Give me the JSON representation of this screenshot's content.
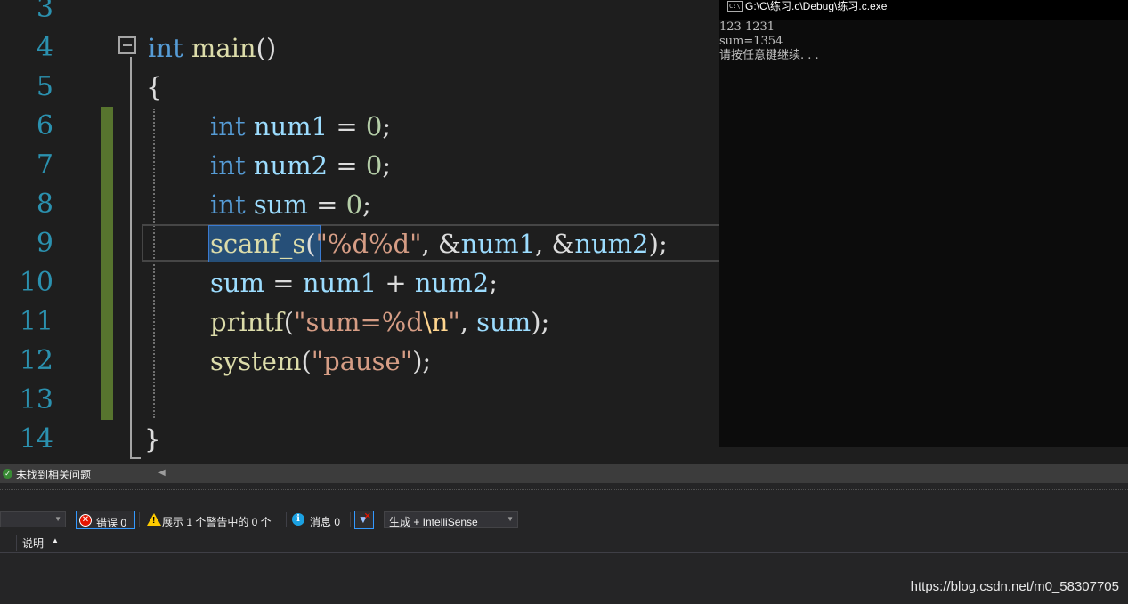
{
  "editor": {
    "line_numbers": [
      "3",
      "4",
      "5",
      "6",
      "7",
      "8",
      "9",
      "10",
      "11",
      "12",
      "13",
      "14"
    ],
    "lines": {
      "l4": {
        "kw": "int",
        "fn": "main",
        "rest": "()"
      },
      "l5": {
        "brace": "{"
      },
      "l6": {
        "kw": "int",
        "var": "num1",
        "op": " = ",
        "num": "0",
        "end": ";"
      },
      "l7": {
        "kw": "int",
        "var": "num2",
        "op": " = ",
        "num": "0",
        "end": ";"
      },
      "l8": {
        "kw": "int",
        "var": "sum",
        "op": " = ",
        "num": "0",
        "end": ";"
      },
      "l9": {
        "fn": "scanf_s",
        "open": "(",
        "str": "\"%d%d\"",
        "c1": ", &",
        "v1": "num1",
        "c2": ", &",
        "v2": "num2",
        "close": ");"
      },
      "l10": {
        "v1": "sum",
        "op1": " = ",
        "v2": "num1",
        "op2": " + ",
        "v3": "num2",
        "end": ";"
      },
      "l11": {
        "fn": "printf",
        "open": "(",
        "str1": "\"sum=%d",
        "esc": "\\n",
        "str2": "\"",
        "c1": ", ",
        "v1": "sum",
        "close": ");"
      },
      "l12": {
        "fn": "system",
        "open": "(",
        "str": "\"pause\"",
        "close": ");"
      },
      "l14": {
        "brace": "}"
      }
    }
  },
  "console": {
    "icon_text": "C:\\",
    "title": "G:\\C\\练习.c\\Debug\\练习.c.exe",
    "output": [
      "123 1231",
      "sum=1354",
      "请按任意键继续. . ."
    ]
  },
  "status": {
    "message": "未找到相关问题",
    "ok_icon": "check-circle-icon"
  },
  "error_list": {
    "errors_label": "错误 0",
    "warnings_label": "展示 1 个警告中的 0 个",
    "messages_label": "消息 0",
    "build_filter": "生成 + IntelliSense",
    "column_description": "说明"
  },
  "watermark": "https://blog.csdn.net/m0_58307705",
  "colors": {
    "keyword": "#569cd6",
    "function": "#dcdcaa",
    "variable": "#9cdcfe",
    "number": "#b5cea8",
    "string": "#d69d85",
    "line_number": "#2b91af",
    "change_bar": "#57742e"
  }
}
